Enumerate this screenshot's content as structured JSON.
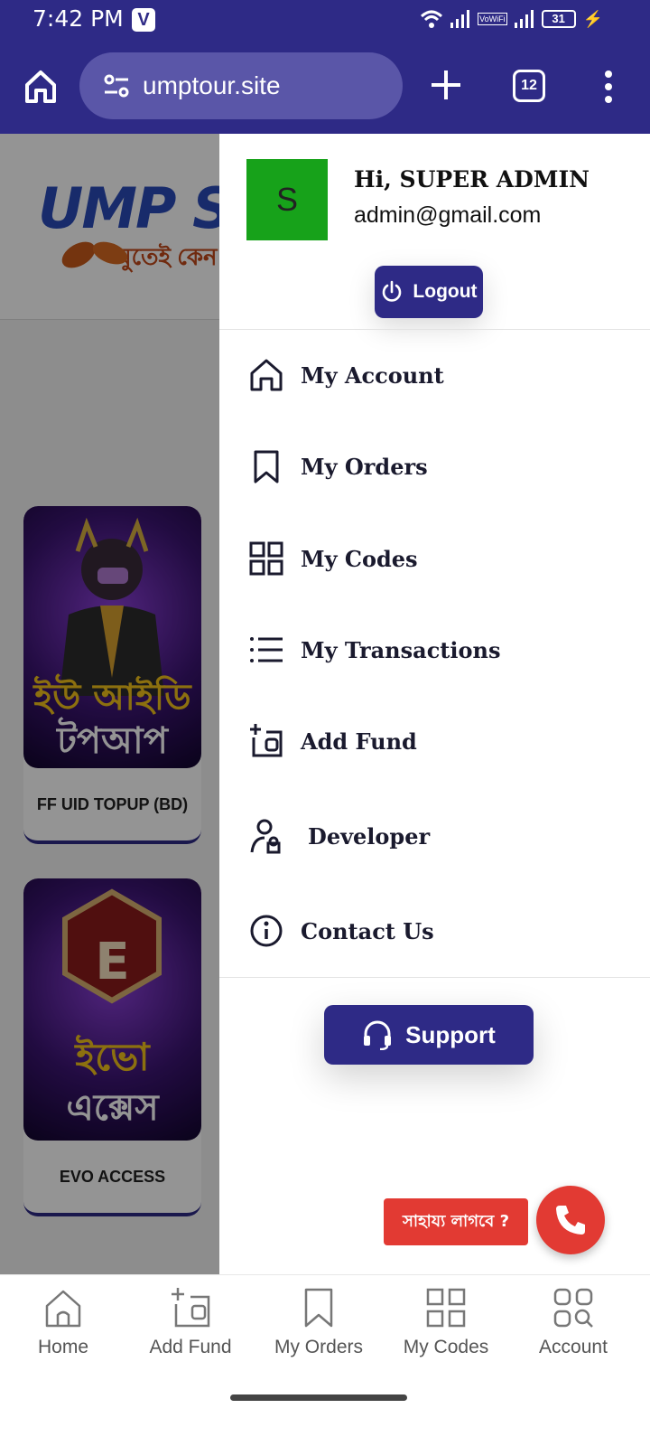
{
  "status_bar": {
    "time": "7:42 PM",
    "app_badge": "V",
    "network_label": "VoWiFi",
    "battery": "31"
  },
  "browser": {
    "url": "umptour.site",
    "tab_count": "12"
  },
  "site": {
    "logo_text": "UMP SH",
    "logo_subtext": "স্মুতেই কেন",
    "products": [
      {
        "label": "FF UID TOPUP (BD)",
        "art_line1": "ইউ আইডি",
        "art_line2": "টপআপ"
      },
      {
        "label": "EVO ACCESS",
        "art_line1": "ইভো",
        "art_line2": "এক্সেস",
        "art_logo": "E"
      }
    ]
  },
  "drawer": {
    "avatar_letter": "S",
    "greeting": "Hi, SUPER ADMIN",
    "email": "admin@gmail.com",
    "logout_label": "Logout",
    "menu": [
      {
        "label": "My Account",
        "icon": "home-icon"
      },
      {
        "label": "My Orders",
        "icon": "bookmark-icon"
      },
      {
        "label": "My Codes",
        "icon": "grid-icon"
      },
      {
        "label": "My Transactions",
        "icon": "list-icon"
      },
      {
        "label": "Add Fund",
        "icon": "wallet-plus-icon"
      },
      {
        "label": "Developer",
        "icon": "user-lock-icon"
      },
      {
        "label": "Contact Us",
        "icon": "info-icon"
      }
    ],
    "support_label": "Support"
  },
  "help": {
    "badge_text": "সাহায্য লাগবে ?"
  },
  "bottom_nav": {
    "items": [
      {
        "label": "Home",
        "icon": "home-icon"
      },
      {
        "label": "Add Fund",
        "icon": "wallet-plus-icon"
      },
      {
        "label": "My Orders",
        "icon": "bookmark-icon"
      },
      {
        "label": "My Codes",
        "icon": "grid-icon"
      },
      {
        "label": "Account",
        "icon": "apps-search-icon"
      }
    ]
  },
  "colors": {
    "primary": "#2e2a86",
    "accent_red": "#e23a33",
    "avatar_green": "#17a21a"
  }
}
